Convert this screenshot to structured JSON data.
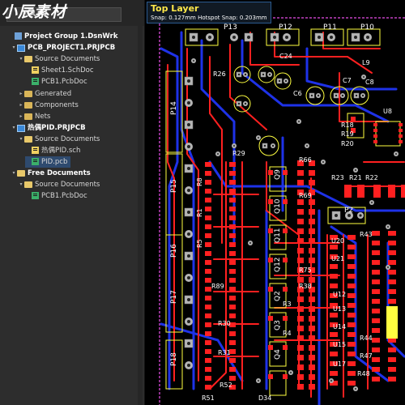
{
  "watermark": "小辰素材",
  "panel": {
    "search_placeholder": "",
    "tree": [
      {
        "label": "Project Group 1.DsnWrk",
        "icon": "group-icon",
        "indent": 0,
        "arrow": "",
        "bold": true,
        "selected": false
      },
      {
        "label": "PCB_PROJECT1.PRJPCB",
        "icon": "project-icon",
        "indent": 1,
        "arrow": "▾",
        "bold": true,
        "selected": false
      },
      {
        "label": "Source Documents",
        "icon": "folder-open-icon",
        "indent": 2,
        "arrow": "▾",
        "bold": false,
        "selected": false
      },
      {
        "label": "Sheet1.SchDoc",
        "icon": "schematic-file-icon",
        "indent": 3,
        "arrow": "",
        "bold": false,
        "selected": false
      },
      {
        "label": "PCB1.PcbDoc",
        "icon": "pcb-file-icon",
        "indent": 3,
        "arrow": "",
        "bold": false,
        "selected": false
      },
      {
        "label": "Generated",
        "icon": "folder-icon",
        "indent": 2,
        "arrow": "▸",
        "bold": false,
        "selected": false
      },
      {
        "label": "Components",
        "icon": "folder-icon",
        "indent": 2,
        "arrow": "▸",
        "bold": false,
        "selected": false
      },
      {
        "label": "Nets",
        "icon": "folder-icon",
        "indent": 2,
        "arrow": "▸",
        "bold": false,
        "selected": false
      },
      {
        "label": "热偶PID.PRJPCB",
        "icon": "project-icon",
        "indent": 1,
        "arrow": "▾",
        "bold": true,
        "selected": false
      },
      {
        "label": "Source Documents",
        "icon": "folder-open-icon",
        "indent": 2,
        "arrow": "▾",
        "bold": false,
        "selected": false
      },
      {
        "label": "热偶PID.sch",
        "icon": "schematic-file-icon",
        "indent": 3,
        "arrow": "",
        "bold": false,
        "selected": false
      },
      {
        "label": "PID.pcb",
        "icon": "pcb-file-icon",
        "indent": 3,
        "arrow": "",
        "bold": false,
        "selected": true
      },
      {
        "label": "Free Documents",
        "icon": "folder-open-icon",
        "indent": 1,
        "arrow": "▾",
        "bold": true,
        "selected": false
      },
      {
        "label": "Source Documents",
        "icon": "folder-open-icon",
        "indent": 2,
        "arrow": "▾",
        "bold": false,
        "selected": false
      },
      {
        "label": "PCB1.PcbDoc",
        "icon": "pcb-file-icon",
        "indent": 3,
        "arrow": "",
        "bold": false,
        "selected": false
      }
    ]
  },
  "canvas": {
    "layer_name": "Top Layer",
    "snap_text": "Snap: 0.127mm Hotspot Snap: 0.203mm",
    "colors": {
      "background": "#000000",
      "top_layer": "#ff2020",
      "bottom_layer": "#1e32e8",
      "pad": "#b4b4b4",
      "silkscreen": "#ffff40",
      "keepout": "#c040c0"
    },
    "designators": {
      "P13": "P13",
      "P12": "P12",
      "P11": "P11",
      "P10": "P10",
      "P14": "P14",
      "P15": "P15",
      "P16": "P16",
      "P17": "P17",
      "P18": "P18",
      "C24": "C24",
      "R26": "R26",
      "L9": "L9",
      "U8": "U8",
      "R18": "R18",
      "R19": "R19",
      "R20": "R20",
      "R29": "R29",
      "Q9": "Q9",
      "Q10": "Q10",
      "Q11": "Q11",
      "Q12": "Q12",
      "Q2": "Q2",
      "Q3": "Q3",
      "Q4": "Q4",
      "R66": "R66",
      "R69": "R69",
      "R75": "R75",
      "R38": "R38",
      "R3": "R3",
      "R4": "R4",
      "R23": "R23",
      "R21": "R21",
      "R22": "R22",
      "P2": "P2",
      "U20": "U20",
      "U21": "U21",
      "U12": "U12",
      "U13": "U13",
      "U14": "U14",
      "U15": "U15",
      "U17": "U17",
      "R43": "R43",
      "R44": "R44",
      "R47": "R47",
      "R48": "R48",
      "R51": "R51",
      "R52": "R52",
      "R89": "R89",
      "D34": "D34",
      "C7": "C7",
      "C8": "C8",
      "C6": "C6",
      "R8": "R8",
      "R1": "R1",
      "R5": "R5",
      "R30": "R30",
      "R31": "R31"
    }
  }
}
